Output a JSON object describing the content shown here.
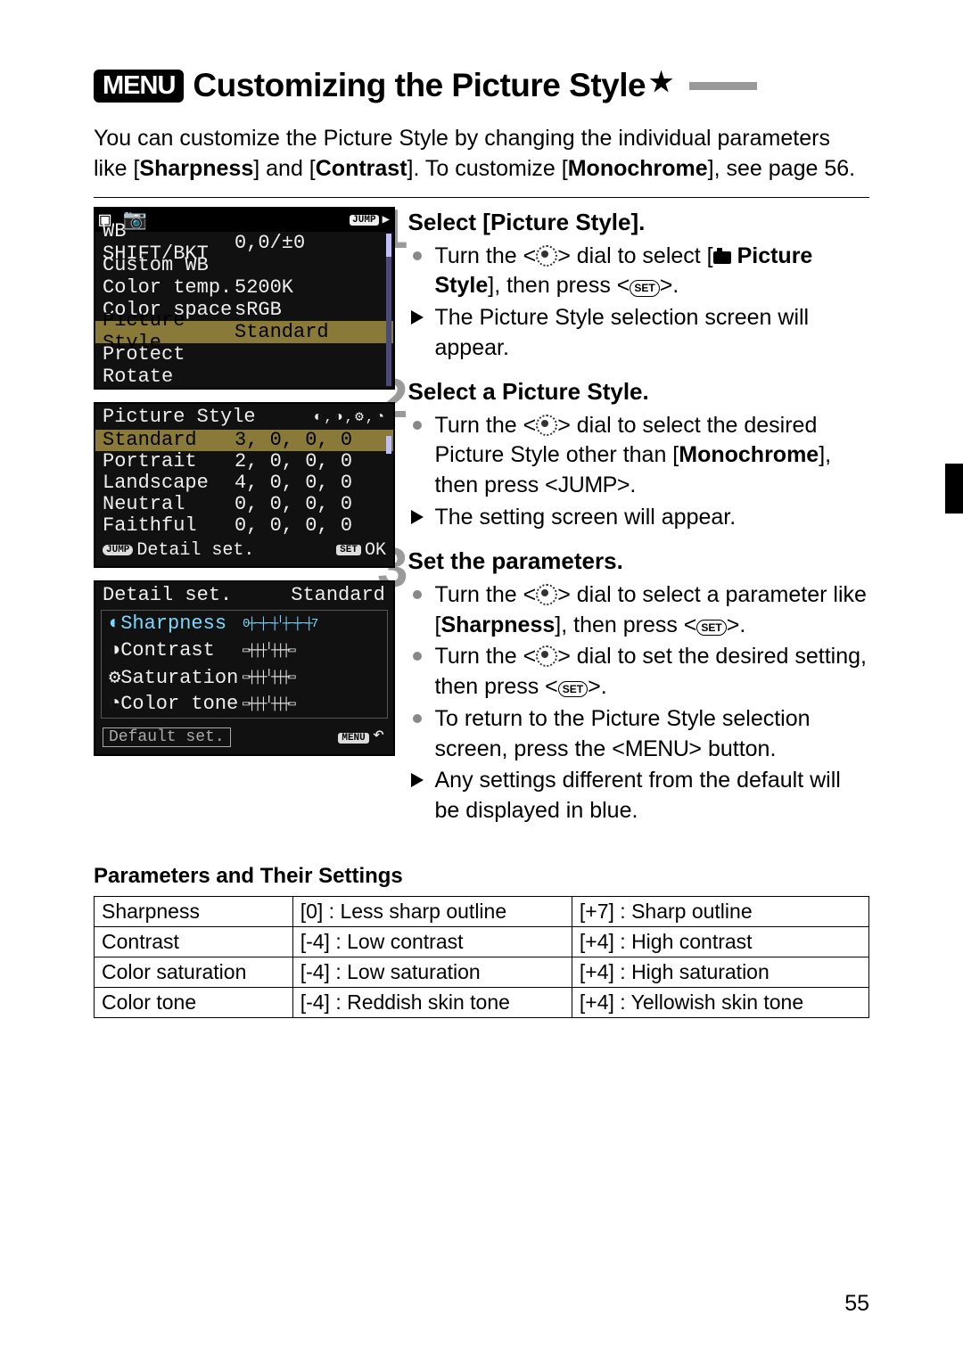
{
  "menu_chip": "MENU",
  "title": "Customizing the Picture Style",
  "intro_parts": {
    "a": "You can customize the Picture Style by changing the individual parameters like [",
    "b": "Sharpness",
    "c": "] and [",
    "d": "Contrast",
    "e": "]. To customize [",
    "f": "Monochrome",
    "g": "], see page 56."
  },
  "lcd1": {
    "jump_label": "JUMP",
    "rows": [
      {
        "label": "WB SHIFT/BKT",
        "value": "0,0/±0",
        "sel": false
      },
      {
        "label": "Custom WB",
        "value": "",
        "sel": false
      },
      {
        "label": "Color temp.",
        "value": "5200K",
        "sel": false
      },
      {
        "label": "Color space",
        "value": "sRGB",
        "sel": false
      },
      {
        "label": "Picture Style",
        "value": "Standard",
        "sel": true
      },
      {
        "label": "Protect",
        "value": "",
        "sel": false
      },
      {
        "label": "Rotate",
        "value": "",
        "sel": false
      }
    ]
  },
  "lcd2": {
    "header": "Picture Style",
    "rows": [
      {
        "label": "Standard",
        "value": "3, 0, 0, 0",
        "hl": true
      },
      {
        "label": "Portrait",
        "value": "2, 0, 0, 0",
        "hl": false
      },
      {
        "label": "Landscape",
        "value": "4, 0, 0, 0",
        "hl": false
      },
      {
        "label": "Neutral",
        "value": "0, 0, 0, 0",
        "hl": false
      },
      {
        "label": "Faithful",
        "value": "0, 0, 0, 0",
        "hl": false
      }
    ],
    "foot_jump": "JUMP",
    "foot_left": "Detail set.",
    "foot_set": "SET",
    "foot_right": "OK"
  },
  "lcd3": {
    "head_l": "Detail set.",
    "head_r": "Standard",
    "params": [
      {
        "name": "Sharpness",
        "slider": "0┼─┼─┼╵┼─┼─┼7",
        "sel": true
      },
      {
        "name": "Contrast",
        "slider": "▭┼┼┼╵┼┼┼▭",
        "sel": false
      },
      {
        "name": "Saturation",
        "slider": "▭┼┼┼╵┼┼┼▭",
        "sel": false
      },
      {
        "name": "Color tone",
        "slider": "▭┼┼┼╵┼┼┼▭",
        "sel": false
      }
    ],
    "default_btn": "Default set.",
    "menu_badge": "MENU"
  },
  "steps": [
    {
      "num": "1",
      "title": "Select [Picture Style].",
      "items": [
        {
          "type": "dot",
          "html": "turn1"
        },
        {
          "type": "tri",
          "text": "The Picture Style selection screen will appear."
        }
      ],
      "turn1_a": "Turn the <",
      "turn1_b": "> dial to select [",
      "turn1_c": "Picture Style",
      "turn1_d": "], then press <",
      "turn1_e": ">."
    },
    {
      "num": "2",
      "title": "Select a Picture Style.",
      "items": [],
      "l1a": "Turn the <",
      "l1b": "> dial to select the desired Picture Style other than [",
      "l1c": "Monochrome",
      "l1d": "], then press <",
      "l1e": "JUMP",
      "l1f": ">.",
      "l2": "The setting screen will appear."
    },
    {
      "num": "3",
      "title": "Set the parameters.",
      "a1": "Turn the <",
      "a2": "> dial to select a parameter like [",
      "a3": "Sharpness",
      "a4": "], then press <",
      "a5": ">.",
      "b1": "Turn the <",
      "b2": "> dial to set the desired setting, then press <",
      "b3": ">.",
      "c1": "To return to the Picture Style selection screen, press the <",
      "c2": "MENU",
      "c3": "> button.",
      "d": "Any settings different from the default will be displayed in blue."
    }
  ],
  "params_section_title": "Parameters and Their Settings",
  "params_table": [
    {
      "name": "Sharpness",
      "low": "[0] : Less sharp outline",
      "high": "[+7] : Sharp outline"
    },
    {
      "name": "Contrast",
      "low": "[-4] : Low contrast",
      "high": "[+4] : High contrast"
    },
    {
      "name": "Color saturation",
      "low": "[-4] : Low saturation",
      "high": "[+4] : High saturation"
    },
    {
      "name": "Color tone",
      "low": "[-4] : Reddish skin tone",
      "high": "[+4] : Yellowish skin tone"
    }
  ],
  "page_number": "55"
}
